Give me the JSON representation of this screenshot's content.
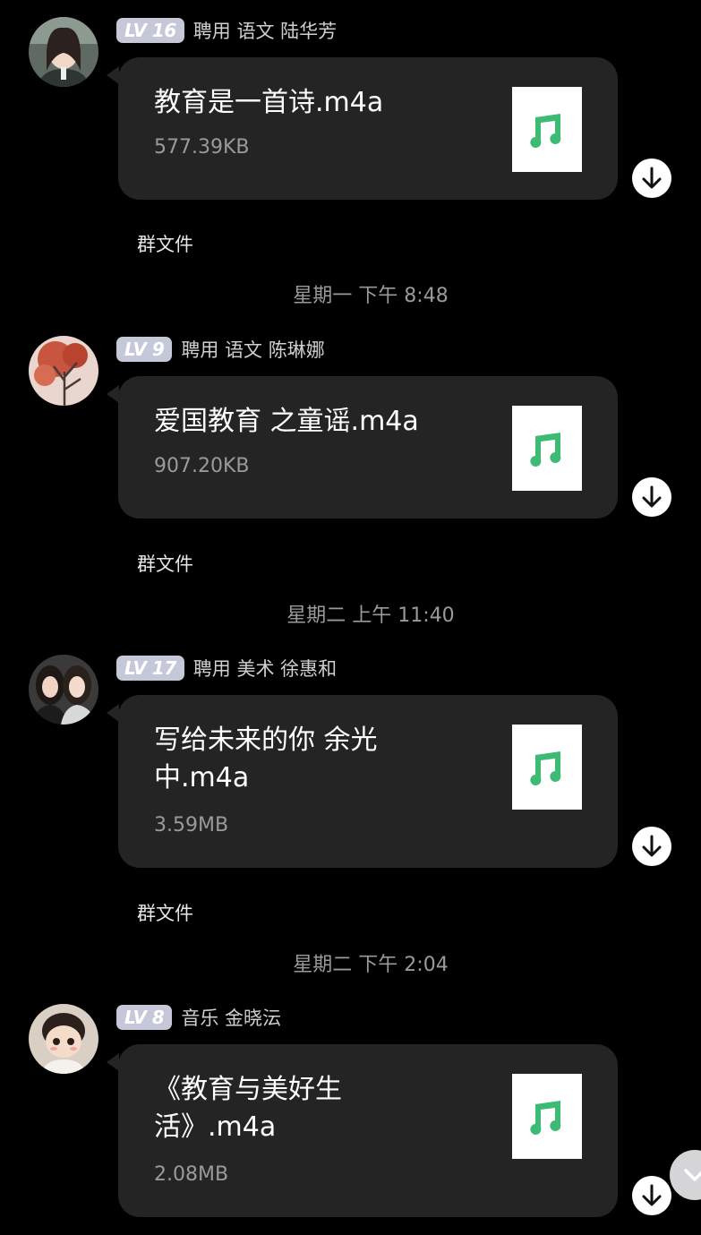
{
  "messages": [
    {
      "level": "LV 16",
      "sender": "聘用 语文 陆华芳",
      "file_name": "教育是一首诗.m4a",
      "file_size": "577.39KB",
      "source": "群文件"
    },
    {
      "level": "LV 9",
      "sender": "聘用 语文 陈琳娜",
      "file_name": "爱国教育 之童谣.m4a",
      "file_size": "907.20KB",
      "source": "群文件"
    },
    {
      "level": "LV 17",
      "sender": "聘用 美术 徐惠和",
      "file_name": "写给未来的你 余光中.m4a",
      "file_size": "3.59MB",
      "source": "群文件"
    },
    {
      "level": "LV 8",
      "sender": "音乐 金晓沄",
      "file_name": "《教育与美好生活》.m4a",
      "file_size": "2.08MB"
    }
  ],
  "timestamps": [
    "星期一 下午 8:48",
    "星期二 上午 11:40",
    "星期二 下午 2:04"
  ],
  "colors": {
    "background": "#000000",
    "bubble": "#242424",
    "music_icon": "#3dbb74",
    "badge": "#c4c8d8"
  },
  "icons": {
    "file": "music-note-icon",
    "download": "download-arrow-icon",
    "scroll": "chevron-down-icon"
  }
}
